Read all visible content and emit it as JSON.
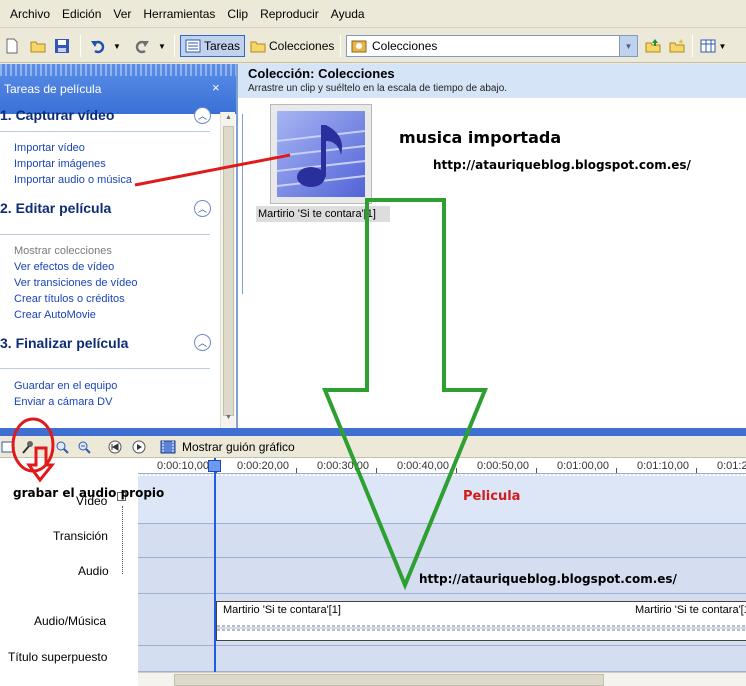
{
  "menu": [
    "Archivo",
    "Edición",
    "Ver",
    "Herramientas",
    "Clip",
    "Reproducir",
    "Ayuda"
  ],
  "toolbar": {
    "tasks_label": "Tareas",
    "collections_label": "Colecciones",
    "collection_select": "Colecciones"
  },
  "taskpane": {
    "title": "Tareas de película",
    "close": "×",
    "sections": [
      {
        "title": "1. Capturar vídeo",
        "items": [
          "Importar vídeo",
          "Importar imágenes",
          "Importar audio o música"
        ]
      },
      {
        "title": "2. Editar película",
        "items": [
          "Mostrar colecciones",
          "Ver efectos de vídeo",
          "Ver transiciones de vídeo",
          "Crear títulos o créditos",
          "Crear AutoMovie"
        ]
      },
      {
        "title": "3. Finalizar película",
        "items": [
          "Guardar en el equipo",
          "Enviar a cámara DV"
        ]
      }
    ]
  },
  "collection": {
    "title": "Colección: Colecciones",
    "subtitle": "Arrastre un clip y suéltelo en la escala de tiempo de abajo.",
    "clip_label": "Martirio 'Si te contara'[1]"
  },
  "storyboard": {
    "label": "Mostrar guión gráfico"
  },
  "timeline": {
    "ticks": [
      "0:00:10,00",
      "0:00:20,00",
      "0:00:30,00",
      "0:00:40,00",
      "0:00:50,00",
      "0:01:00,00",
      "0:01:10,00",
      "0:01:2"
    ],
    "tracks": [
      "Vídeo",
      "Transición",
      "Audio",
      "Audio/Música",
      "Título superpuesto"
    ],
    "music_clip_left": "Martirio 'Si te contara'[1]",
    "music_clip_right": "Martirio 'Si te contara'[1"
  },
  "annotations": {
    "musica": "musica importada",
    "url": "http://atauriqueblog.blogspot.com.es/",
    "pelicula": "Pelicula",
    "grabar": "grabar el audio propio"
  },
  "colors": {
    "accent": "#316ac5",
    "annotation_red": "#e0191b",
    "annotation_green": "#2ea032"
  }
}
